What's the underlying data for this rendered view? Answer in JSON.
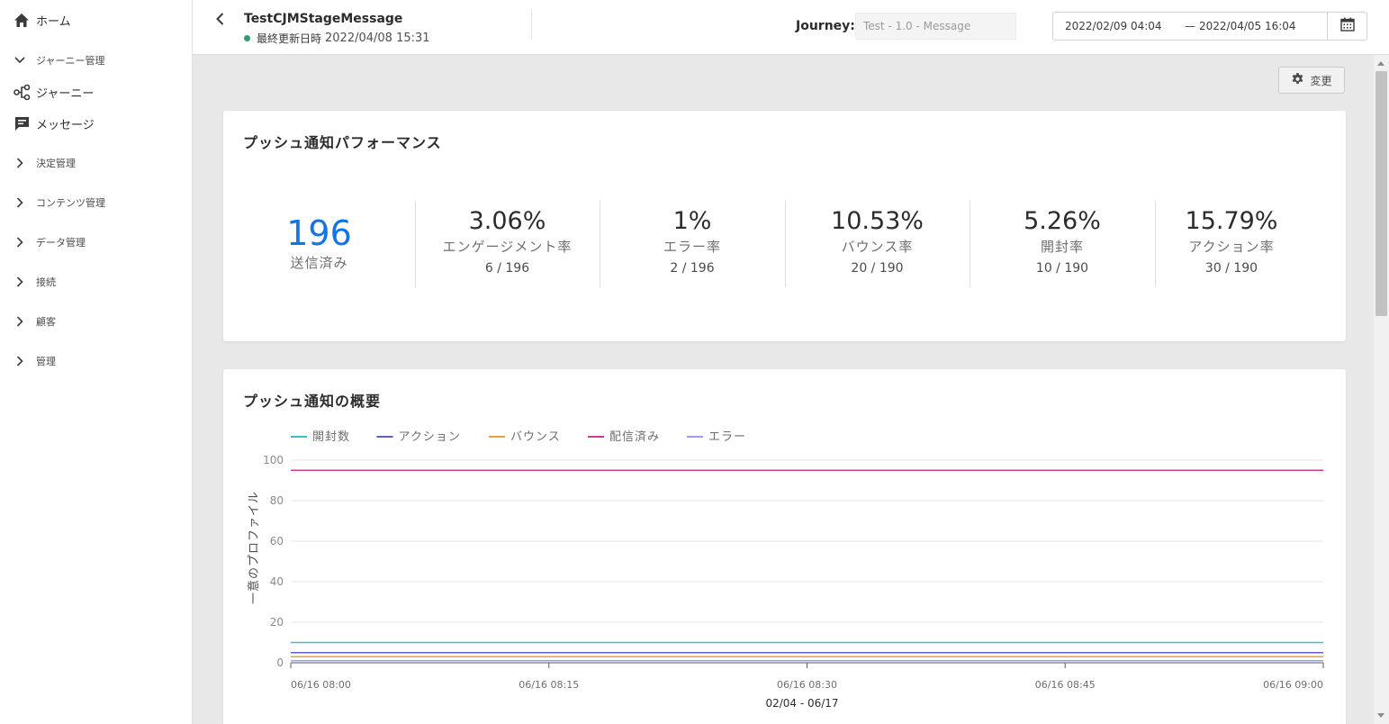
{
  "sidebar": {
    "home": "ホーム",
    "journey_management": "ジャーニー管理",
    "journeys": "ジャーニー",
    "messages": "メッセージ",
    "decision_management": "決定管理",
    "content_management": "コンテンツ管理",
    "data_management": "データ管理",
    "connections": "接続",
    "customers": "顧客",
    "administration": "管理"
  },
  "header": {
    "title": "TestCJMStageMessage",
    "status_label": "最終更新日時",
    "status_time": "2022/04/08 15:31",
    "journey_label": "Journey:",
    "journey_value": "Test - 1.0 - Message",
    "date_start": "2022/02/09 04:04",
    "date_separator": "—",
    "date_end": "2022/04/05 16:04"
  },
  "toolbar": {
    "change_label": "変更"
  },
  "performance": {
    "title": "プッシュ通知パフォーマンス",
    "sent": {
      "value": "196",
      "label": "送信済み"
    },
    "metrics": [
      {
        "value": "3.06%",
        "label": "エンゲージメント率",
        "fraction": "6 / 196"
      },
      {
        "value": "1%",
        "label": "エラー率",
        "fraction": "2 / 196"
      },
      {
        "value": "10.53%",
        "label": "バウンス率",
        "fraction": "20 / 190"
      },
      {
        "value": "5.26%",
        "label": "開封率",
        "fraction": "10 / 190"
      },
      {
        "value": "15.79%",
        "label": "アクション率",
        "fraction": "30 / 190"
      }
    ]
  },
  "overview": {
    "title": "プッシュ通知の概要"
  },
  "colors": {
    "accent_blue": "#1473e6",
    "status_green": "#2d9d78"
  },
  "chart_data": {
    "type": "line",
    "title": "",
    "xlabel": "02/04 - 06/17",
    "ylabel": "一意のプロファイル",
    "x": [
      "06/16 08:00",
      "06/16 08:15",
      "06/16 08:30",
      "06/16 08:45",
      "06/16 09:00"
    ],
    "ylim": [
      0,
      100
    ],
    "yticks": [
      0,
      20,
      40,
      60,
      80,
      100
    ],
    "grid": true,
    "legend_position": "top-left",
    "series": [
      {
        "name": "開封数",
        "color": "#2fc6c9",
        "values": [
          10,
          10,
          10,
          10,
          10
        ]
      },
      {
        "name": "アクション",
        "color": "#5a5fc9",
        "values": [
          5,
          5,
          5,
          5,
          5
        ]
      },
      {
        "name": "バウンス",
        "color": "#e8a03a",
        "values": [
          3,
          3,
          3,
          3,
          3
        ]
      },
      {
        "name": "配信済み",
        "color": "#d83790",
        "values": [
          95,
          95,
          95,
          95,
          95
        ]
      },
      {
        "name": "エラー",
        "color": "#9e9ee8",
        "values": [
          1,
          1,
          1,
          1,
          1
        ]
      }
    ]
  }
}
